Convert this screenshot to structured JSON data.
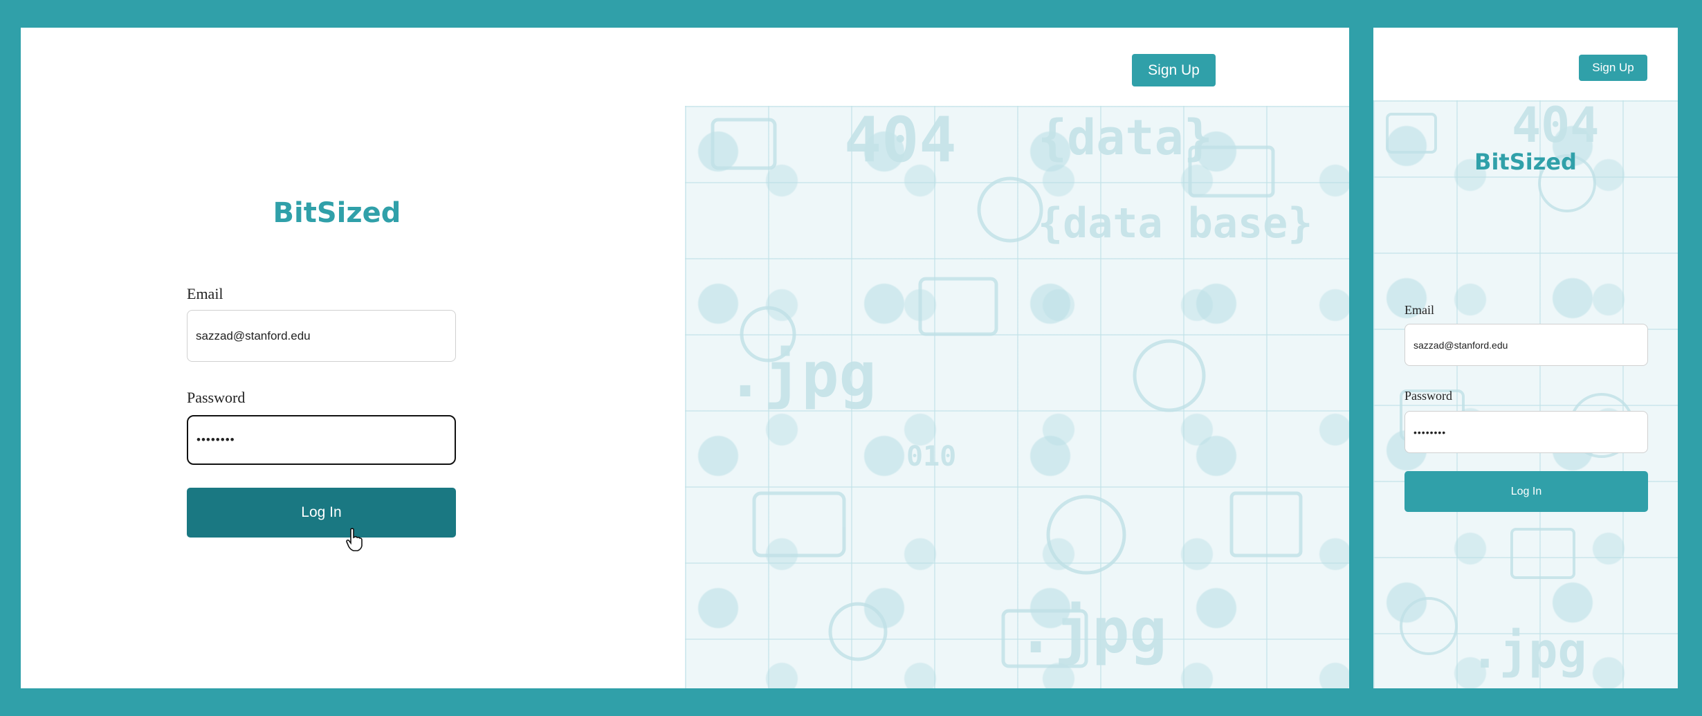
{
  "header": {
    "signup_label": "Sign Up"
  },
  "brand": {
    "name": "BitSized",
    "color": "#30a0a9"
  },
  "form": {
    "email_label": "Email",
    "email_value": "sazzad@stanford.edu",
    "password_label": "Password",
    "password_value": "••••••••",
    "login_label": "Log In"
  },
  "colors": {
    "accent": "#30a0a9",
    "login_hover": "#1a7882",
    "background_frame": "#30a0a9"
  },
  "icons": [
    "hand-pointer-cursor-icon"
  ]
}
